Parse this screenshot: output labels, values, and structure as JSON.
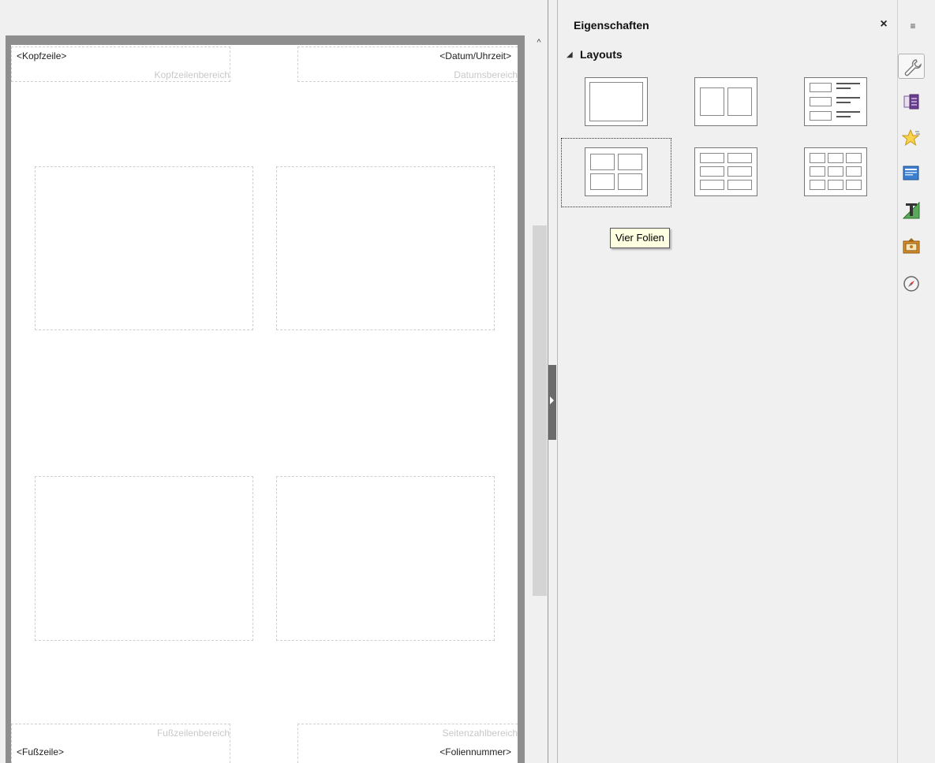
{
  "page": {
    "header_field": "<Kopfzeile>",
    "header_area": "Kopfzeilenbereich",
    "date_field": "<Datum/Uhrzeit>",
    "date_area": "Datumsbereich",
    "footer_field": "<Fußzeile>",
    "footer_area": "Fußzeilenbereich",
    "page_number_field": "<Foliennummer>",
    "page_number_area": "Seitenzahlbereich"
  },
  "scrollbar": {
    "up_arrow": "^"
  },
  "sidebar": {
    "title": "Eigenschaften",
    "close": "×",
    "panel": {
      "arrow": "◢",
      "label": "Layouts"
    },
    "layouts": [
      {
        "id": "one-slide"
      },
      {
        "id": "two-slides"
      },
      {
        "id": "three-slides-notes"
      },
      {
        "id": "four-slides",
        "selected": true
      },
      {
        "id": "six-slides"
      },
      {
        "id": "nine-slides"
      }
    ],
    "tooltip": "Vier Folien"
  },
  "tabbar": {
    "menu_icon": "≡",
    "tabs": [
      {
        "icon": "wrench-icon",
        "active": true
      },
      {
        "icon": "slide-transition-icon"
      },
      {
        "icon": "animation-star-icon"
      },
      {
        "icon": "master-slides-icon"
      },
      {
        "icon": "styles-icon"
      },
      {
        "icon": "gallery-icon"
      },
      {
        "icon": "navigator-icon"
      }
    ]
  },
  "colors": {
    "page_background": "#ffffff",
    "frame": "#8e8e8e",
    "sidebar_background": "#f0f0f0",
    "tooltip_background": "#ffffe1"
  }
}
